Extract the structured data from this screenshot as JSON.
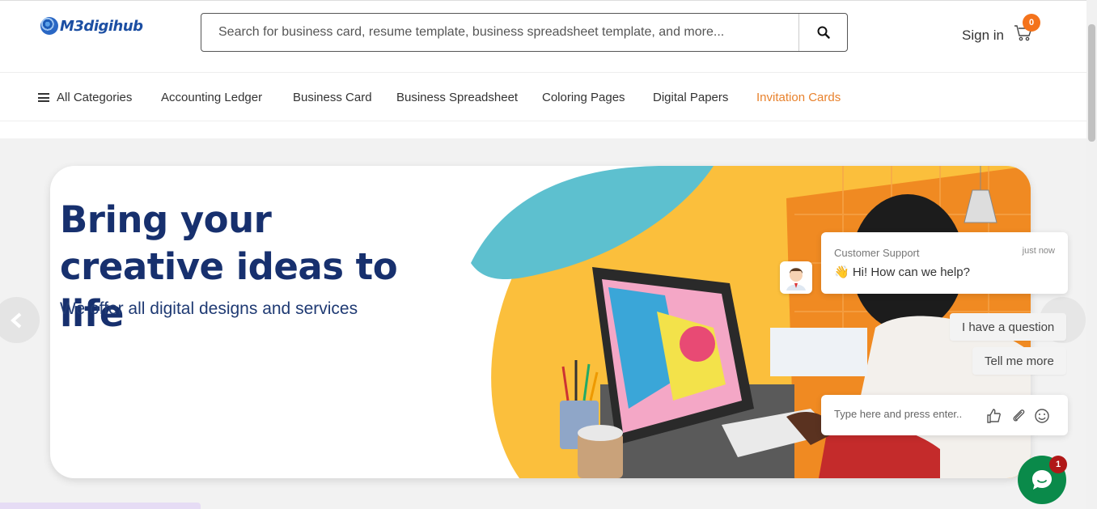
{
  "header": {
    "logo_text": "M3digihub",
    "search_placeholder": "Search for business card, resume template, business spreadsheet template, and more...",
    "signin_label": "Sign in",
    "cart_count": "0"
  },
  "nav": {
    "all_categories": "All Categories",
    "items": [
      "Accounting Ledger",
      "Business Card",
      "Business Spreadsheet",
      "Coloring Pages",
      "Digital Papers",
      "Invitation Cards"
    ]
  },
  "hero": {
    "headline": "Bring your creative ideas to life",
    "subheadline": "We offer all digital designs and services"
  },
  "chat": {
    "agent_name": "Customer Support",
    "timestamp": "just now",
    "message": "👋 Hi! How can we help?",
    "quick_replies": [
      "I have a question",
      "Tell me more"
    ],
    "input_placeholder": "Type here and press enter..",
    "launcher_badge": "1"
  },
  "colors": {
    "brand_navy": "#17306e",
    "accent_orange": "#e8822d",
    "cart_badge": "#f4731c",
    "chat_green": "#0a8a4a"
  }
}
